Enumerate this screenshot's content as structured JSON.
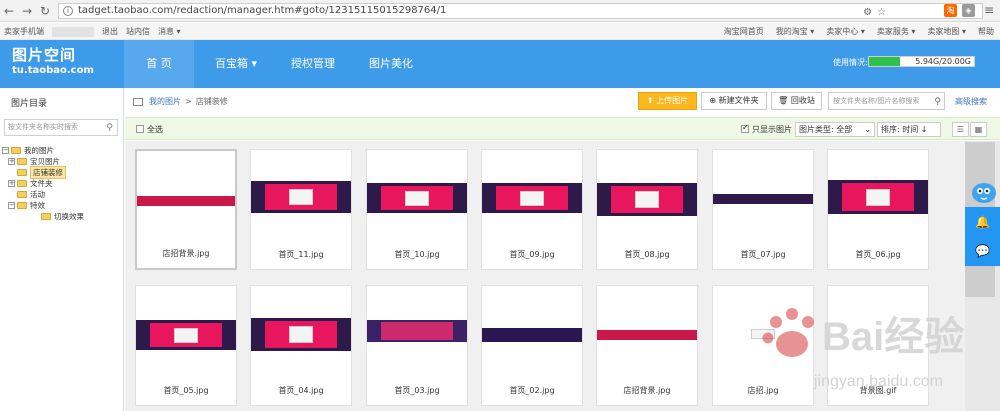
{
  "browser": {
    "url": "tadget.taobao.com/redaction/manager.htm#goto/12315115015298764/1"
  },
  "sitebar": {
    "left": [
      "卖家手机端",
      "退出",
      "站内信",
      "消息"
    ],
    "right": [
      "淘宝网首页",
      "我的淘宝",
      "卖家中心",
      "卖家服务",
      "卖家地图",
      "帮助"
    ]
  },
  "header": {
    "logo_title": "图片空间",
    "logo_domain": "tu.taobao.com",
    "tabs": [
      {
        "label": "首 页",
        "active": true
      },
      {
        "label": "百宝箱",
        "dropdown": true
      },
      {
        "label": "授权管理"
      },
      {
        "label": "图片美化"
      }
    ],
    "usage_label": "使用情况:",
    "usage_text": "5.94G/20.00G",
    "usage_fraction": 0.297
  },
  "sidebar": {
    "title": "图片目录",
    "search_placeholder": "按文件夹名称实时搜索",
    "tree": [
      {
        "label": "我的图片",
        "toggle": "⊟",
        "level": 0
      },
      {
        "label": "宝贝图片",
        "toggle": "⊞",
        "level": 1
      },
      {
        "label": "店铺装修",
        "level": 1,
        "selected": true
      },
      {
        "label": "文件夹",
        "toggle": "⊞",
        "level": 1
      },
      {
        "label": "活动",
        "level": 1
      },
      {
        "label": "特效",
        "toggle": "⊟",
        "level": 1
      },
      {
        "label": "切换效果",
        "level": 2
      }
    ]
  },
  "breadcrumb": {
    "root": "我的图片",
    "separator": ">",
    "current": "店铺装修"
  },
  "toolbar": {
    "upload": "上传图片",
    "new_folder": "新建文件夹",
    "recycle": "回收站",
    "search_placeholder": "按文件夹名称/图片名称搜索",
    "advanced": "高级搜索"
  },
  "filter": {
    "select_all": "全选",
    "only_images": "只显示图片",
    "type_label": "图片类型:",
    "type_value": "全部",
    "sort_label": "排序:",
    "sort_value": "时间 ↓"
  },
  "images": [
    {
      "name": "店招背景.jpg"
    },
    {
      "name": "首页_11.jpg"
    },
    {
      "name": "首页_10.jpg"
    },
    {
      "name": "首页_09.jpg"
    },
    {
      "name": "首页_08.jpg"
    },
    {
      "name": "首页_07.jpg"
    },
    {
      "name": "首页_06.jpg"
    },
    {
      "name": "首页_05.jpg"
    },
    {
      "name": "首页_04.jpg"
    },
    {
      "name": "首页_03.jpg"
    },
    {
      "name": "首页_02.jpg"
    },
    {
      "name": "店招背景.jpg"
    },
    {
      "name": "店招.jpg"
    },
    {
      "name": "背景图.gif"
    }
  ],
  "colors": {
    "header_blue": "#3d9be9",
    "upload_orange": "#fcb71c",
    "banner_purple": "#2d1a4a",
    "banner_pink": "#e8175d",
    "usage_green": "#2fc14a"
  },
  "watermark": {
    "text": "Bai经验",
    "domain": "jingyan.baidu.com"
  }
}
